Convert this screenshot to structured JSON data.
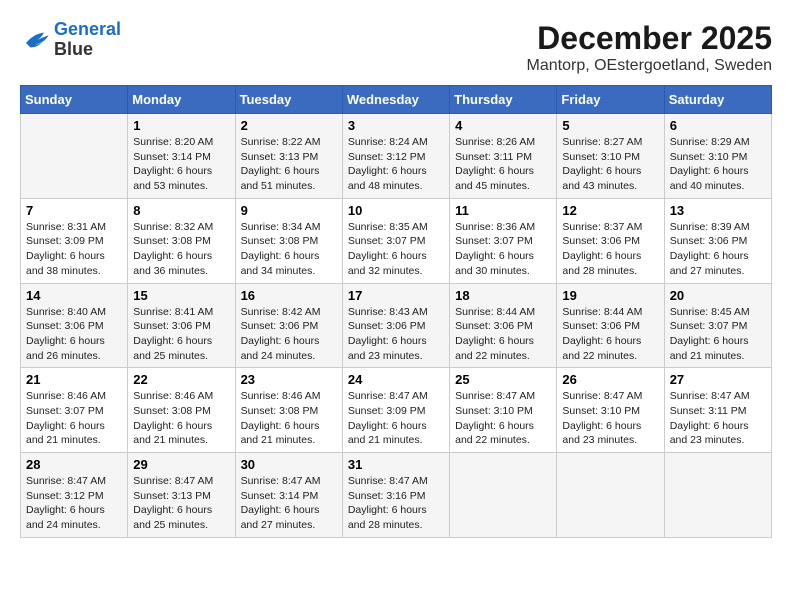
{
  "logo": {
    "line1": "General",
    "line2": "Blue"
  },
  "title": "December 2025",
  "location": "Mantorp, OEstergoetland, Sweden",
  "weekdays": [
    "Sunday",
    "Monday",
    "Tuesday",
    "Wednesday",
    "Thursday",
    "Friday",
    "Saturday"
  ],
  "weeks": [
    [
      {
        "day": "",
        "info": ""
      },
      {
        "day": "1",
        "info": "Sunrise: 8:20 AM\nSunset: 3:14 PM\nDaylight: 6 hours\nand 53 minutes."
      },
      {
        "day": "2",
        "info": "Sunrise: 8:22 AM\nSunset: 3:13 PM\nDaylight: 6 hours\nand 51 minutes."
      },
      {
        "day": "3",
        "info": "Sunrise: 8:24 AM\nSunset: 3:12 PM\nDaylight: 6 hours\nand 48 minutes."
      },
      {
        "day": "4",
        "info": "Sunrise: 8:26 AM\nSunset: 3:11 PM\nDaylight: 6 hours\nand 45 minutes."
      },
      {
        "day": "5",
        "info": "Sunrise: 8:27 AM\nSunset: 3:10 PM\nDaylight: 6 hours\nand 43 minutes."
      },
      {
        "day": "6",
        "info": "Sunrise: 8:29 AM\nSunset: 3:10 PM\nDaylight: 6 hours\nand 40 minutes."
      }
    ],
    [
      {
        "day": "7",
        "info": "Sunrise: 8:31 AM\nSunset: 3:09 PM\nDaylight: 6 hours\nand 38 minutes."
      },
      {
        "day": "8",
        "info": "Sunrise: 8:32 AM\nSunset: 3:08 PM\nDaylight: 6 hours\nand 36 minutes."
      },
      {
        "day": "9",
        "info": "Sunrise: 8:34 AM\nSunset: 3:08 PM\nDaylight: 6 hours\nand 34 minutes."
      },
      {
        "day": "10",
        "info": "Sunrise: 8:35 AM\nSunset: 3:07 PM\nDaylight: 6 hours\nand 32 minutes."
      },
      {
        "day": "11",
        "info": "Sunrise: 8:36 AM\nSunset: 3:07 PM\nDaylight: 6 hours\nand 30 minutes."
      },
      {
        "day": "12",
        "info": "Sunrise: 8:37 AM\nSunset: 3:06 PM\nDaylight: 6 hours\nand 28 minutes."
      },
      {
        "day": "13",
        "info": "Sunrise: 8:39 AM\nSunset: 3:06 PM\nDaylight: 6 hours\nand 27 minutes."
      }
    ],
    [
      {
        "day": "14",
        "info": "Sunrise: 8:40 AM\nSunset: 3:06 PM\nDaylight: 6 hours\nand 26 minutes."
      },
      {
        "day": "15",
        "info": "Sunrise: 8:41 AM\nSunset: 3:06 PM\nDaylight: 6 hours\nand 25 minutes."
      },
      {
        "day": "16",
        "info": "Sunrise: 8:42 AM\nSunset: 3:06 PM\nDaylight: 6 hours\nand 24 minutes."
      },
      {
        "day": "17",
        "info": "Sunrise: 8:43 AM\nSunset: 3:06 PM\nDaylight: 6 hours\nand 23 minutes."
      },
      {
        "day": "18",
        "info": "Sunrise: 8:44 AM\nSunset: 3:06 PM\nDaylight: 6 hours\nand 22 minutes."
      },
      {
        "day": "19",
        "info": "Sunrise: 8:44 AM\nSunset: 3:06 PM\nDaylight: 6 hours\nand 22 minutes."
      },
      {
        "day": "20",
        "info": "Sunrise: 8:45 AM\nSunset: 3:07 PM\nDaylight: 6 hours\nand 21 minutes."
      }
    ],
    [
      {
        "day": "21",
        "info": "Sunrise: 8:46 AM\nSunset: 3:07 PM\nDaylight: 6 hours\nand 21 minutes."
      },
      {
        "day": "22",
        "info": "Sunrise: 8:46 AM\nSunset: 3:08 PM\nDaylight: 6 hours\nand 21 minutes."
      },
      {
        "day": "23",
        "info": "Sunrise: 8:46 AM\nSunset: 3:08 PM\nDaylight: 6 hours\nand 21 minutes."
      },
      {
        "day": "24",
        "info": "Sunrise: 8:47 AM\nSunset: 3:09 PM\nDaylight: 6 hours\nand 21 minutes."
      },
      {
        "day": "25",
        "info": "Sunrise: 8:47 AM\nSunset: 3:10 PM\nDaylight: 6 hours\nand 22 minutes."
      },
      {
        "day": "26",
        "info": "Sunrise: 8:47 AM\nSunset: 3:10 PM\nDaylight: 6 hours\nand 23 minutes."
      },
      {
        "day": "27",
        "info": "Sunrise: 8:47 AM\nSunset: 3:11 PM\nDaylight: 6 hours\nand 23 minutes."
      }
    ],
    [
      {
        "day": "28",
        "info": "Sunrise: 8:47 AM\nSunset: 3:12 PM\nDaylight: 6 hours\nand 24 minutes."
      },
      {
        "day": "29",
        "info": "Sunrise: 8:47 AM\nSunset: 3:13 PM\nDaylight: 6 hours\nand 25 minutes."
      },
      {
        "day": "30",
        "info": "Sunrise: 8:47 AM\nSunset: 3:14 PM\nDaylight: 6 hours\nand 27 minutes."
      },
      {
        "day": "31",
        "info": "Sunrise: 8:47 AM\nSunset: 3:16 PM\nDaylight: 6 hours\nand 28 minutes."
      },
      {
        "day": "",
        "info": ""
      },
      {
        "day": "",
        "info": ""
      },
      {
        "day": "",
        "info": ""
      }
    ]
  ]
}
